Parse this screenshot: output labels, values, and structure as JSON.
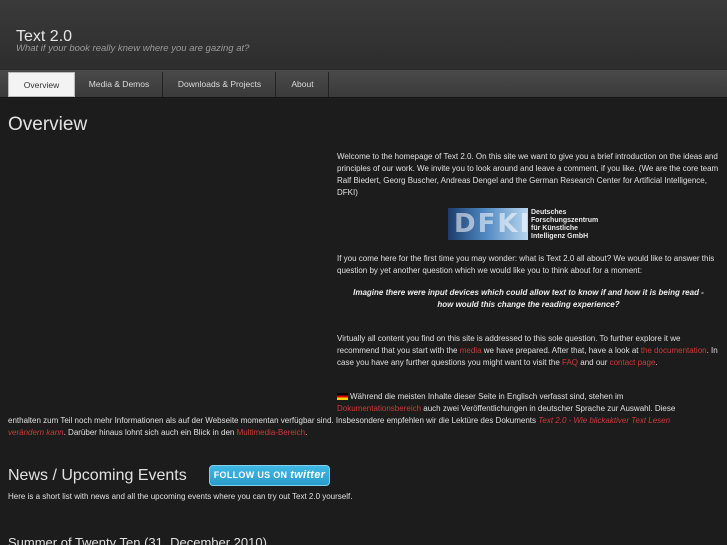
{
  "header": {
    "title": "Text 2.0",
    "tagline": "What if your book really knew where you are gazing at?"
  },
  "nav": {
    "items": [
      "Overview",
      "Media & Demos",
      "Downloads & Projects",
      "About"
    ],
    "active": "Overview"
  },
  "overview": {
    "heading": "Overview",
    "intro": "Welcome to the homepage of Text 2.0. On this site we want to give you a brief introduction on the ideas and principles of our work. We invite you to look around and leave a comment, if you like. (We are the core team Ralf Biedert, Georg Buscher, Andreas Dengel and the German Research Center for Artificial Intelligence, DFKI)",
    "dfki_logo": {
      "mark": "DFKI",
      "line1": "Deutsches",
      "line2": "Forschungszentrum",
      "line3": "für Künstliche",
      "line4": "Intelligenz GmbH"
    },
    "question_intro": "If you come here for the first time you may wonder: what is Text 2.0 all about? We would like to answer this question by yet another question which we would like you to think about for a moment:",
    "quote_line1": "Imagine there were input devices which could allow text to know if and how it is being read -",
    "quote_line2": "how would this change the reading experience?",
    "explore": {
      "part1": "Virtually all content you find on this site is addressed to this sole question. To further explore it we recommend that you start with the ",
      "link_media": "media",
      "part2": " we have prepared. After that, have a look at ",
      "link_doc_a": "the",
      "link_doc_b": "documentation",
      "part3": ". In case you have any further questions you might want to visit the ",
      "link_faq": "FAQ",
      "part4": " and our ",
      "link_contact_a": "contact",
      "link_contact_b": "page",
      "part5": "."
    },
    "german": {
      "line1": "Während die meisten Inhalte dieser Seite in Englisch verfasst sind, stehen im",
      "link_doku": "Dokumentationsbereich",
      "line2": " auch zwei Veröffentlichungen in deutscher Sprache zur Auswahl. Diese",
      "line3a": "enthalten zum Teil noch mehr Informationen als auf der Webseite momentan verfügbar sind. Insbesondere empfehlen wir die Lektüre des Dokuments ",
      "link_doc_title_a": "Text 2.0 - Wie blickaktiver Text Lesen",
      "link_doc_title_b": "verändern kann",
      "line4": ". Darüber hinaus lohnt sich auch ein Blick in den ",
      "link_multimedia": "Multimedia-Bereich",
      "line5": "."
    }
  },
  "news": {
    "heading": "News / Upcoming Events",
    "twitter_prefix": "FOLLOW US ON",
    "twitter_brand": "twitter",
    "intro": "Here is a short list with news and all the upcoming events where you can try out Text 2.0 yourself.",
    "first_item_heading": "Summer of Twenty Ten (31. December 2010)"
  }
}
